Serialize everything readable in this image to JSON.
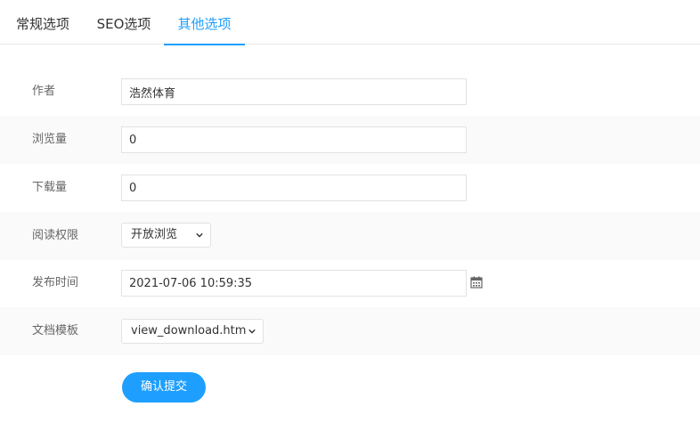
{
  "tabs": [
    {
      "label": "常规选项",
      "active": false
    },
    {
      "label": "SEO选项",
      "active": false
    },
    {
      "label": "其他选项",
      "active": true
    }
  ],
  "form": {
    "author": {
      "label": "作者",
      "value": "浩然体育"
    },
    "views": {
      "label": "浏览量",
      "value": "0"
    },
    "downloads": {
      "label": "下载量",
      "value": "0"
    },
    "read_permission": {
      "label": "阅读权限",
      "selected": "开放浏览"
    },
    "publish_time": {
      "label": "发布时间",
      "value": "2021-07-06 10:59:35",
      "icon": "calendar-icon"
    },
    "doc_template": {
      "label": "文档模板",
      "selected": "view_download.htm"
    }
  },
  "submit_label": "确认提交",
  "colors": {
    "accent": "#1e9fff",
    "row_shade": "#fafafa",
    "border": "#e2e2e2"
  }
}
